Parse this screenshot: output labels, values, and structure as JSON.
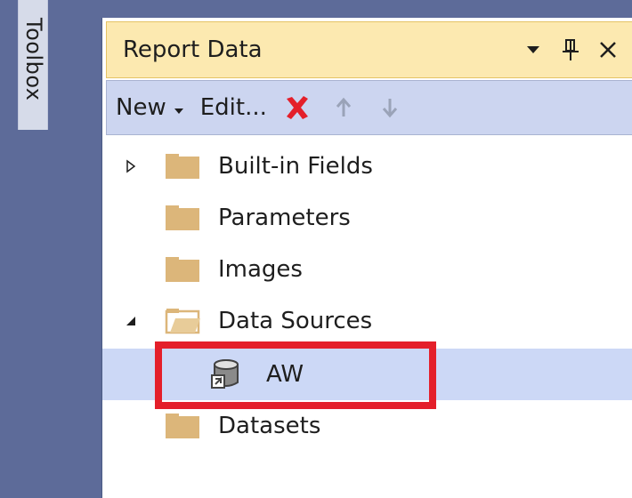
{
  "toolbox": {
    "label": "Toolbox"
  },
  "panel": {
    "title": "Report Data",
    "controls": {
      "dropdown_icon": "chevron-down-icon",
      "pin_icon": "pin-icon",
      "close_icon": "close-icon"
    }
  },
  "toolbar": {
    "new_label": "New",
    "edit_label": "Edit...",
    "delete_icon": "delete-x-icon",
    "up_icon": "arrow-up-icon",
    "down_icon": "arrow-down-icon",
    "delete_color": "#e41f2a"
  },
  "tree": {
    "items": [
      {
        "label": "Built-in Fields",
        "expander": "collapsed"
      },
      {
        "label": "Parameters"
      },
      {
        "label": "Images"
      },
      {
        "label": "Data Sources",
        "expander": "expanded"
      },
      {
        "label": "AW",
        "selected": true
      },
      {
        "label": "Datasets"
      }
    ]
  },
  "colors": {
    "background": "#5d6b99",
    "titlebar": "#fce9b0",
    "toolbar": "#ccd5f0",
    "selection": "#ccd8f6",
    "folder": "#dcb67a",
    "highlight": "#e41f2a"
  }
}
